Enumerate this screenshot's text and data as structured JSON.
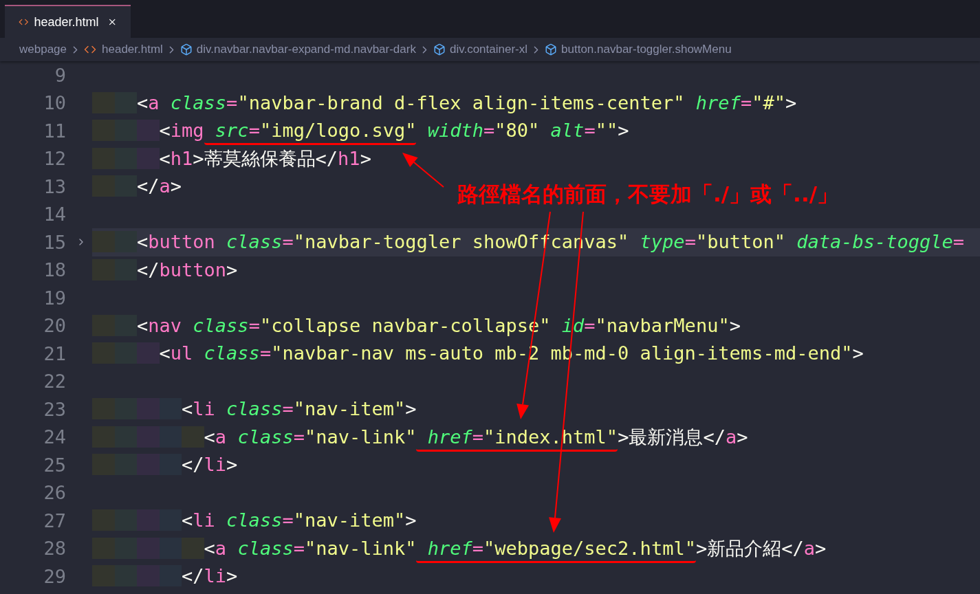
{
  "tab": {
    "label": "header.html",
    "selected": true
  },
  "breadcrumbs": [
    {
      "kind": "folder",
      "label": "webpage"
    },
    {
      "kind": "file",
      "label": "header.html"
    },
    {
      "kind": "element",
      "label": "div.navbar.navbar-expand-md.navbar-dark"
    },
    {
      "kind": "element",
      "label": "div.container-xl"
    },
    {
      "kind": "element",
      "label": "button.navbar-toggler.showMenu"
    }
  ],
  "lines": [
    {
      "number": "9",
      "current": false,
      "folded": false
    },
    {
      "number": "10",
      "current": false,
      "folded": false,
      "parts": [
        {
          "underlined": false,
          "code": "    <a class=\"navbar-brand d-flex align-items-center\" href=\"#\">"
        }
      ]
    },
    {
      "number": "11",
      "current": false,
      "folded": false,
      "parts": [
        {
          "underlined": false,
          "code": "      <img"
        },
        {
          "underlined": true,
          "code": " src=\"img/logo.svg\""
        },
        {
          "underlined": false,
          "code": " width=\"80\" alt=\"\">"
        }
      ]
    },
    {
      "number": "12",
      "current": false,
      "folded": false,
      "parts": [
        {
          "underlined": false,
          "code": "      <h1>蒂莫絲保養品</h1>"
        }
      ]
    },
    {
      "number": "13",
      "current": false,
      "folded": false,
      "parts": [
        {
          "underlined": false,
          "code": "    </a>"
        }
      ]
    },
    {
      "number": "14",
      "current": false,
      "folded": false
    },
    {
      "number": "15",
      "current": true,
      "folded": true,
      "parts": [
        {
          "underlined": false,
          "code": "    <button class=\"navbar-toggler showOffcanvas\" type=\"button\" data-bs-toggle="
        }
      ]
    },
    {
      "number": "18",
      "current": false,
      "folded": false,
      "parts": [
        {
          "underlined": false,
          "code": "    </button>"
        }
      ]
    },
    {
      "number": "19",
      "current": false,
      "folded": false
    },
    {
      "number": "20",
      "current": false,
      "folded": false,
      "parts": [
        {
          "underlined": false,
          "code": "    <nav class=\"collapse navbar-collapse\" id=\"navbarMenu\">"
        }
      ]
    },
    {
      "number": "21",
      "current": false,
      "folded": false,
      "parts": [
        {
          "underlined": false,
          "code": "      <ul class=\"navbar-nav ms-auto mb-2 mb-md-0 align-items-md-end\">"
        }
      ]
    },
    {
      "number": "22",
      "current": false,
      "folded": false
    },
    {
      "number": "23",
      "current": false,
      "folded": false,
      "parts": [
        {
          "underlined": false,
          "code": "        <li class=\"nav-item\">"
        }
      ]
    },
    {
      "number": "24",
      "current": false,
      "folded": false,
      "parts": [
        {
          "underlined": false,
          "code": "          <a class=\"nav-link\""
        },
        {
          "underlined": true,
          "code": " href=\"index.html\""
        },
        {
          "underlined": false,
          "code": ">最新消息</a>"
        }
      ]
    },
    {
      "number": "25",
      "current": false,
      "folded": false,
      "parts": [
        {
          "underlined": false,
          "code": "        </li>"
        }
      ]
    },
    {
      "number": "26",
      "current": false,
      "folded": false
    },
    {
      "number": "27",
      "current": false,
      "folded": false,
      "parts": [
        {
          "underlined": false,
          "code": "        <li class=\"nav-item\">"
        }
      ]
    },
    {
      "number": "28",
      "current": false,
      "folded": false,
      "parts": [
        {
          "underlined": false,
          "code": "          <a class=\"nav-link\""
        },
        {
          "underlined": true,
          "code": " href=\"webpage/sec2.html\""
        },
        {
          "underlined": false,
          "code": ">新品介紹</a>"
        }
      ]
    },
    {
      "number": "29",
      "current": false,
      "folded": false,
      "parts": [
        {
          "underlined": false,
          "code": "        </li>"
        }
      ]
    }
  ],
  "annotation": {
    "note": "路徑檔名的前面，不要加「./」或「../」"
  }
}
